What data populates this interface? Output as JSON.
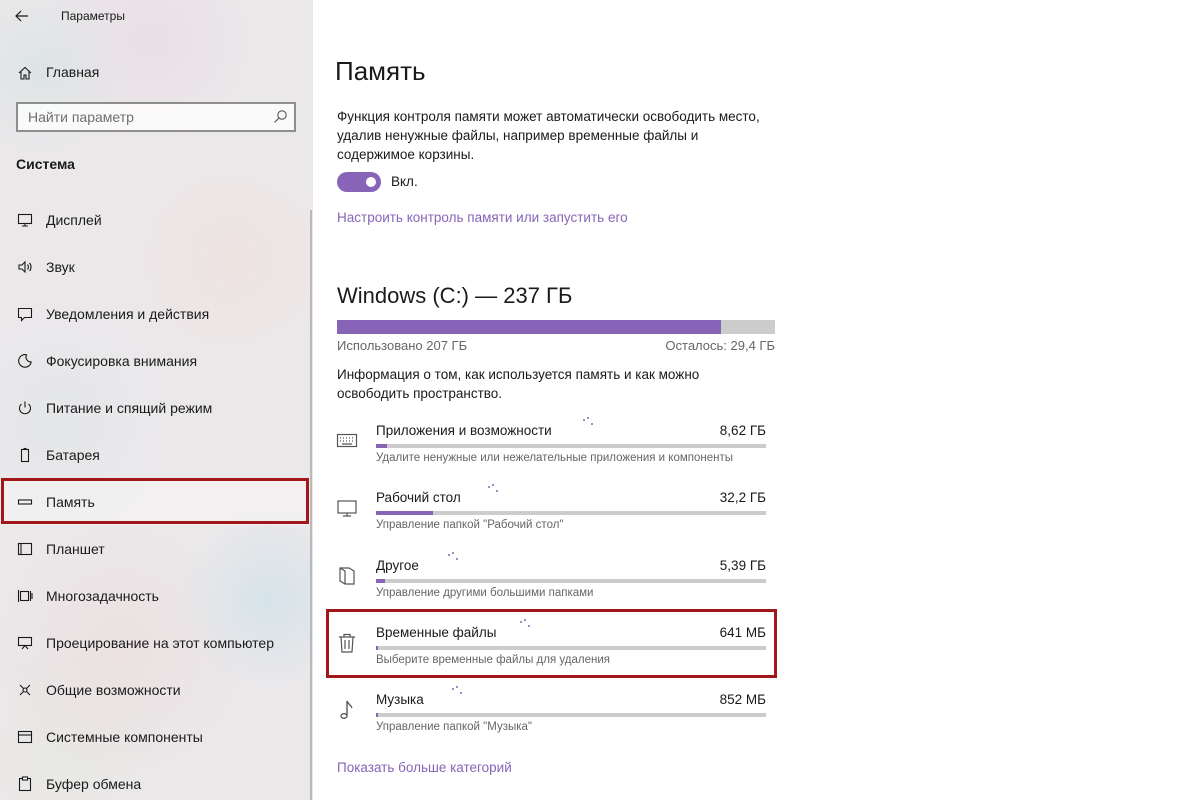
{
  "window": {
    "title": "Параметры"
  },
  "sidebar": {
    "home_label": "Главная",
    "search_placeholder": "Найти параметр",
    "section_title": "Система",
    "items": [
      {
        "label": "Дисплей",
        "icon": "display-icon"
      },
      {
        "label": "Звук",
        "icon": "speaker-icon"
      },
      {
        "label": "Уведомления и действия",
        "icon": "notification-icon"
      },
      {
        "label": "Фокусировка внимания",
        "icon": "focus-assist-icon"
      },
      {
        "label": "Питание и спящий режим",
        "icon": "power-icon"
      },
      {
        "label": "Батарея",
        "icon": "battery-icon"
      },
      {
        "label": "Память",
        "icon": "storage-icon",
        "selected": true
      },
      {
        "label": "Планшет",
        "icon": "tablet-icon"
      },
      {
        "label": "Многозадачность",
        "icon": "multitasking-icon"
      },
      {
        "label": "Проецирование на этот компьютер",
        "icon": "projecting-icon"
      },
      {
        "label": "Общие возможности",
        "icon": "shared-experiences-icon"
      },
      {
        "label": "Системные компоненты",
        "icon": "system-components-icon"
      },
      {
        "label": "Буфер обмена",
        "icon": "clipboard-icon"
      }
    ]
  },
  "main": {
    "title": "Память",
    "description": "Функция контроля памяти может автоматически освободить место, удалив ненужные файлы, например временные файлы и содержимое корзины.",
    "toggle": {
      "state": "Вкл.",
      "on": true
    },
    "configure_link": "Настроить контроль памяти или запустить его",
    "drive": {
      "title": "Windows (C:) — 237 ГБ",
      "used_label": "Использовано 207 ГБ",
      "free_label": "Осталось: 29,4 ГБ",
      "used_fraction": 0.876
    },
    "info": "Информация о том, как используется память и как можно освободить пространство.",
    "categories": [
      {
        "name": "Приложения и возможности",
        "size": "8,62 ГБ",
        "subtitle": "Удалите ненужные или нежелательные приложения и компоненты",
        "icon": "apps-features-icon",
        "fraction": 0.027
      },
      {
        "name": "Рабочий стол",
        "size": "32,2 ГБ",
        "subtitle": "Управление папкой \"Рабочий стол\"",
        "icon": "desktop-monitor-icon",
        "fraction": 0.145
      },
      {
        "name": "Другое",
        "size": "5,39 ГБ",
        "subtitle": "Управление другими большими папками",
        "icon": "other-folders-icon",
        "fraction": 0.024
      },
      {
        "name": "Временные файлы",
        "size": "641 МБ",
        "subtitle": "Выберите временные файлы для удаления",
        "icon": "trash-icon",
        "fraction": 0.003
      },
      {
        "name": "Музыка",
        "size": "852 МБ",
        "subtitle": "Управление папкой \"Музыка\"",
        "icon": "music-icon",
        "fraction": 0.004
      }
    ],
    "show_more_link": "Показать больше категорий"
  },
  "colors": {
    "accent": "#8764b8",
    "highlight": "#a3161a",
    "bar_track": "#cccccc"
  }
}
